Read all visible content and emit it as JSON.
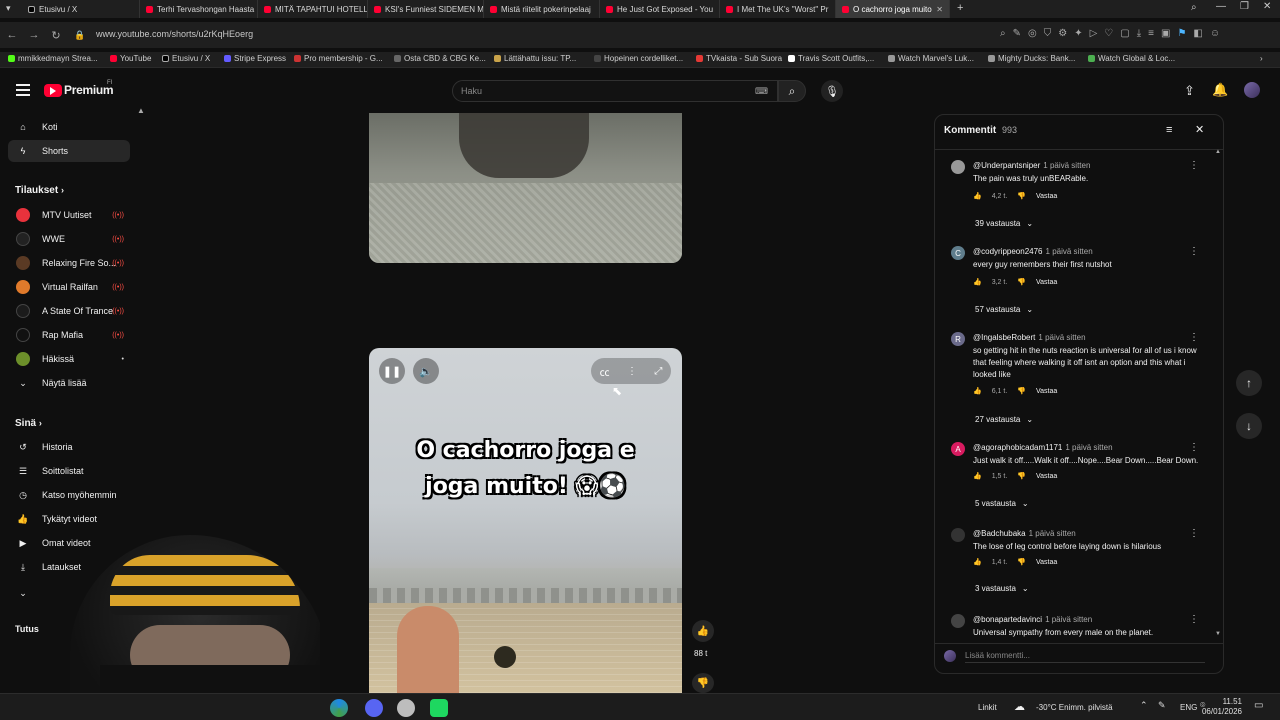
{
  "tabs": [
    {
      "label": "Etusivu / X",
      "icon": "x-icon"
    },
    {
      "label": "Terhi Tervashongan Haasta",
      "icon": "youtube-icon"
    },
    {
      "label": "MITÄ TAPAHTUI HOTELLI",
      "icon": "youtube-icon"
    },
    {
      "label": "KSI's Funniest SIDEMEN M",
      "icon": "youtube-icon"
    },
    {
      "label": "Mistä riitelit pokerinpelaaj",
      "icon": "youtube-icon"
    },
    {
      "label": "He Just Got Exposed - You",
      "icon": "youtube-icon"
    },
    {
      "label": "I Met The UK's \"Worst\" Pr",
      "icon": "youtube-icon"
    },
    {
      "label": "O cachorro joga muito",
      "icon": "youtube-icon"
    }
  ],
  "address": {
    "url": "www.youtube.com/shorts/u2rKqHEoerg"
  },
  "bookmarks": [
    "mmikkedmayn Strea...",
    "YouTube",
    "Etusivu / X",
    "Stripe Express",
    "Pro membership - G...",
    "Osta CBD & CBG Ke...",
    "Lättähattu issu: TP...",
    "Hopeinen cordelliket...",
    "TVkaista - Sub Suora",
    "Travis Scott Outfits,...",
    "Watch Marvel's Luk...",
    "Mighty Ducks: Bank...",
    "Watch Global & Loc..."
  ],
  "yt": {
    "logo_text": "Premium",
    "logo_sup": "FI",
    "search_placeholder": "Haku"
  },
  "sidebar": {
    "main": [
      {
        "label": "Koti",
        "icon": "home-icon"
      },
      {
        "label": "Shorts",
        "icon": "shorts-icon"
      }
    ],
    "subs_heading": "Tilaukset",
    "subs": [
      {
        "label": "MTV Uutiset",
        "color": "#e8323c"
      },
      {
        "label": "WWE",
        "color": "#222222"
      },
      {
        "label": "Relaxing Fire So...",
        "color": "#5a3a24"
      },
      {
        "label": "Virtual Railfan",
        "color": "#e07a2b"
      },
      {
        "label": "A State Of Trance",
        "color": "#1b1b1b"
      },
      {
        "label": "Rap Mafia",
        "color": "#111111"
      },
      {
        "label": "Häkissä",
        "color": "#6c8f2a"
      },
      {
        "label": "Näytä lisää",
        "color": ""
      }
    ],
    "you_heading": "Sinä",
    "you": [
      {
        "label": "Historia",
        "icon": "history-icon"
      },
      {
        "label": "Soittolistat",
        "icon": "playlist-icon"
      },
      {
        "label": "Katso myöhemmin",
        "icon": "clock-icon"
      },
      {
        "label": "Tykätyt videot",
        "icon": "thumb-up-icon"
      },
      {
        "label": "Omat videot",
        "icon": "video-icon"
      },
      {
        "label": "Lataukset",
        "icon": "download-icon"
      }
    ],
    "more_heading": "Tutus"
  },
  "short": {
    "caption_line1": "O cachorro joga e",
    "caption_line2": "joga muito! 😱⚽",
    "like_count": "88 t"
  },
  "comments": {
    "title": "Kommentit",
    "count": "993",
    "add_placeholder": "Lisää kommentti...",
    "items": [
      {
        "author": "@Underpantsniper",
        "time": "1 päivä sitten",
        "text": "The pain was truly unBEARable.",
        "likes": "4,2 t.",
        "reply": "Vastaa",
        "replies": "39 vastausta",
        "avatar_color": "#888888",
        "avatar_letter": ""
      },
      {
        "author": "@codyrippeon2476",
        "time": "1 päivä sitten",
        "text": "every guy remembers their first nutshot",
        "likes": "3,2 t.",
        "reply": "Vastaa",
        "replies": "57 vastausta",
        "avatar_color": "#5f7d8c",
        "avatar_letter": "C"
      },
      {
        "author": "@IngalsbeRobert",
        "time": "1 päivä sitten",
        "text": "so getting hit in the nuts reaction is universal for all of us i know that feeling where walking it off isnt an option and this what i looked like",
        "likes": "6,1 t.",
        "reply": "Vastaa",
        "replies": "27 vastausta",
        "avatar_color": "#6a6a8a",
        "avatar_letter": "R"
      },
      {
        "author": "@agoraphobicadam1171",
        "time": "1 päivä sitten",
        "text": "Just walk it off.....Walk it off....Nope....Bear Down.....Bear Down.",
        "likes": "1,5 t.",
        "reply": "Vastaa",
        "replies": "5 vastausta",
        "avatar_color": "#d81b60",
        "avatar_letter": "A"
      },
      {
        "author": "@Badchubaka",
        "time": "1 päivä sitten",
        "text": "The lose of leg control before laying down is hilarious",
        "likes": "1,4 t.",
        "reply": "Vastaa",
        "replies": "3 vastausta",
        "avatar_color": "#333333",
        "avatar_letter": ""
      },
      {
        "author": "@bonapartedavinci",
        "time": "1 päivä sitten",
        "text": "Universal sympathy from every male on the planet.",
        "likes": "",
        "reply": "",
        "replies": "",
        "avatar_color": "#444444",
        "avatar_letter": ""
      }
    ]
  },
  "taskbar": {
    "links": "Linkit",
    "weather": "-30°C  Enimm. pilvistä",
    "lang": "ENG",
    "time": "11.51",
    "date": "06/01/2026"
  }
}
